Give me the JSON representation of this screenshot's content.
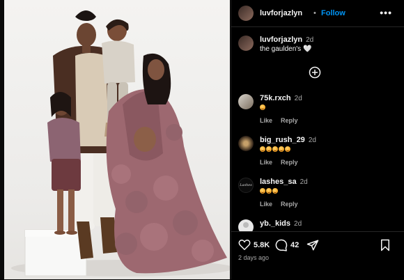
{
  "post": {
    "author": "luvforjazlyn",
    "follow_label": "Follow",
    "separator": "•",
    "caption": "the gaulden's 🤍",
    "caption_time": "2d",
    "likes": "5.8K",
    "comments_count": "42",
    "posted_ago": "2 days ago"
  },
  "comments": [
    {
      "user": "75k.rxch",
      "time": "2d",
      "emoji_count": 1,
      "like_label": "Like",
      "reply_label": "Reply"
    },
    {
      "user": "big_rush_29",
      "time": "2d",
      "emoji_count": 5,
      "like_label": "Like",
      "reply_label": "Reply"
    },
    {
      "user": "lashes_sa",
      "time": "2d",
      "emoji_count": 3,
      "like_label": "Like",
      "reply_label": "Reply",
      "avatar_text": "Lashes"
    },
    {
      "user": "yb._kids",
      "time": "2d"
    }
  ],
  "icons": {
    "more": "more-icon",
    "add_comment": "plus-circle-icon",
    "heart": "heart-icon",
    "comment": "comment-icon",
    "share": "share-icon",
    "save": "bookmark-icon"
  },
  "colors": {
    "accent": "#0095f6",
    "background": "#000000",
    "muted_text": "#a8a8a8",
    "dress": "#9d6870"
  }
}
